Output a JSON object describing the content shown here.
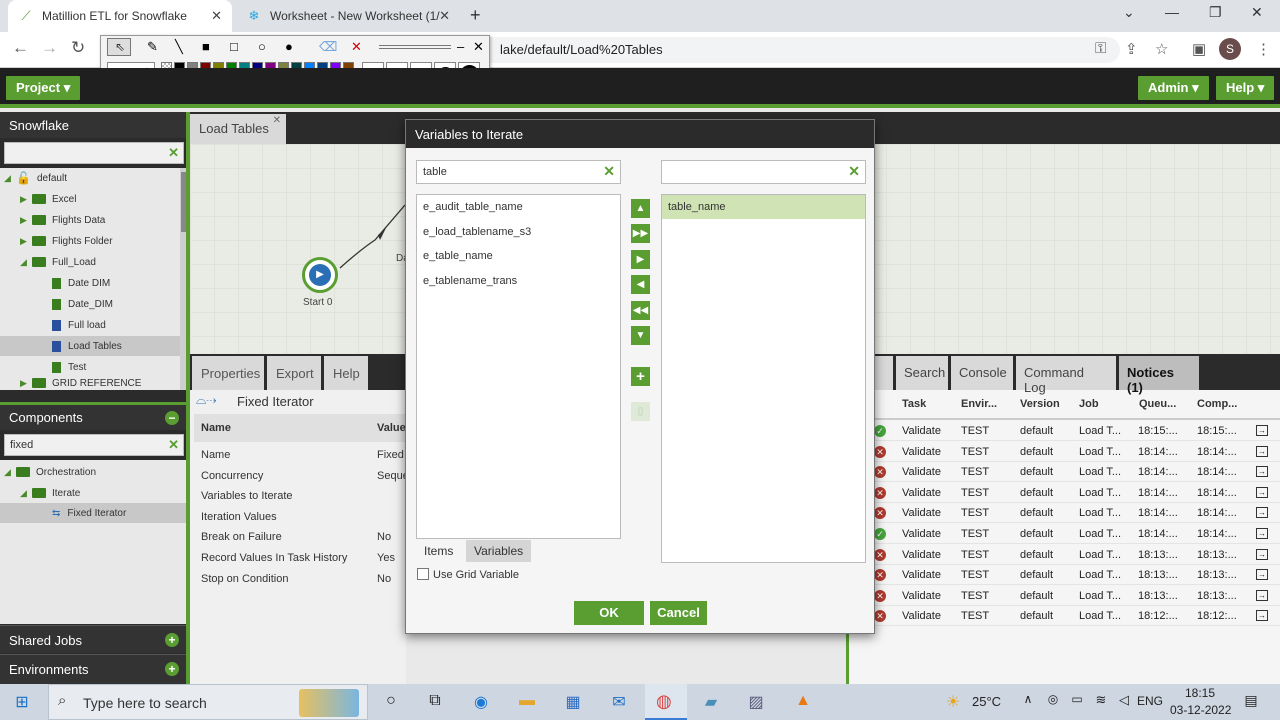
{
  "browser": {
    "tabs": [
      {
        "title": "Matillion ETL for Snowflake",
        "icon": "matillion-icon"
      },
      {
        "title": "Worksheet - New Worksheet (1/",
        "icon": "snowflake-icon"
      }
    ],
    "url": "lake/default/Load%20Tables",
    "profile_initial": "S"
  },
  "header": {
    "project": "Project",
    "admin": "Admin",
    "help": "Help"
  },
  "explorer": {
    "title": "Snowflake",
    "search": "",
    "tree": [
      {
        "label": "default",
        "type": "lock"
      },
      {
        "label": "Excel",
        "type": "folder"
      },
      {
        "label": "Flights Data",
        "type": "folder"
      },
      {
        "label": "Flights Folder",
        "type": "folder"
      },
      {
        "label": "Full_Load",
        "type": "folder-open"
      },
      {
        "label": "Date DIM",
        "type": "job"
      },
      {
        "label": "Date_DIM",
        "type": "job"
      },
      {
        "label": "Full load",
        "type": "job-blue"
      },
      {
        "label": "Load Tables",
        "type": "job-blue"
      },
      {
        "label": "Test",
        "type": "job"
      },
      {
        "label": "GRID REFERENCE",
        "type": "folder"
      }
    ]
  },
  "components": {
    "title": "Components",
    "search": "fixed",
    "tree": [
      {
        "label": "Orchestration"
      },
      {
        "label": "Iterate"
      },
      {
        "label": "Fixed Iterator"
      }
    ]
  },
  "bottom_left": {
    "shared_jobs": "Shared Jobs",
    "environments": "Environments"
  },
  "canvas": {
    "tab": "Load Tables",
    "start_label": "Start 0",
    "next_label": "Da"
  },
  "properties": {
    "tabs": [
      "Properties",
      "Export",
      "Help"
    ],
    "component": "Fixed Iterator",
    "columns": [
      "Name",
      "Value"
    ],
    "rows": [
      {
        "name": "Name",
        "value": "Fixed"
      },
      {
        "name": "Concurrency",
        "value": "Seque"
      },
      {
        "name": "Variables to Iterate",
        "value": ""
      },
      {
        "name": "Iteration Values",
        "value": ""
      },
      {
        "name": "Break on Failure",
        "value": "No"
      },
      {
        "name": "Record Values In Task History",
        "value": "Yes"
      },
      {
        "name": "Stop on Condition",
        "value": "No"
      }
    ]
  },
  "dialog": {
    "title": "Variables to Iterate",
    "left_search": "table",
    "right_search": "",
    "available": [
      "e_audit_table_name",
      "e_load_tablename_s3",
      "e_table_name",
      "e_tablename_trans"
    ],
    "selected": [
      "table_name"
    ],
    "list_tabs": [
      "Items",
      "Variables"
    ],
    "grid_checkbox": "Use Grid Variable",
    "ok": "OK",
    "cancel": "Cancel"
  },
  "tasks": {
    "tabs": [
      "ks",
      "Search",
      "Console",
      "Command Log",
      "Notices (1)"
    ],
    "columns": [
      "Task",
      "Envir...",
      "Version",
      "Job",
      "Queu...",
      "Comp..."
    ],
    "rows": [
      {
        "status": "ok",
        "task": "Validate",
        "env": "TEST",
        "version": "default",
        "job": "Load T...",
        "queued": "18:15:...",
        "completed": "18:15:..."
      },
      {
        "status": "bad",
        "task": "Validate",
        "env": "TEST",
        "version": "default",
        "job": "Load T...",
        "queued": "18:14:...",
        "completed": "18:14:..."
      },
      {
        "status": "bad",
        "task": "Validate",
        "env": "TEST",
        "version": "default",
        "job": "Load T...",
        "queued": "18:14:...",
        "completed": "18:14:..."
      },
      {
        "status": "bad",
        "task": "Validate",
        "env": "TEST",
        "version": "default",
        "job": "Load T...",
        "queued": "18:14:...",
        "completed": "18:14:..."
      },
      {
        "status": "bad",
        "task": "Validate",
        "env": "TEST",
        "version": "default",
        "job": "Load T...",
        "queued": "18:14:...",
        "completed": "18:14:..."
      },
      {
        "status": "ok",
        "task": "Validate",
        "env": "TEST",
        "version": "default",
        "job": "Load T...",
        "queued": "18:14:...",
        "completed": "18:14:..."
      },
      {
        "status": "bad",
        "task": "Validate",
        "env": "TEST",
        "version": "default",
        "job": "Load T...",
        "queued": "18:13:...",
        "completed": "18:13:..."
      },
      {
        "status": "bad",
        "task": "Validate",
        "env": "TEST",
        "version": "default",
        "job": "Load T...",
        "queued": "18:13:...",
        "completed": "18:13:..."
      },
      {
        "status": "bad",
        "task": "Validate",
        "env": "TEST",
        "version": "default",
        "job": "Load T...",
        "queued": "18:13:...",
        "completed": "18:13:..."
      },
      {
        "status": "bad",
        "task": "Validate",
        "env": "TEST",
        "version": "default",
        "job": "Load T...",
        "queued": "18:12:...",
        "completed": "18:12:..."
      }
    ]
  },
  "taskbar": {
    "search_placeholder": "Type here to search",
    "weather": "25°C",
    "lang": "ENG",
    "time": "18:15",
    "date": "03-12-2022"
  },
  "colors": {
    "accent": "#5a9e32",
    "dark": "#2b2b2b"
  }
}
